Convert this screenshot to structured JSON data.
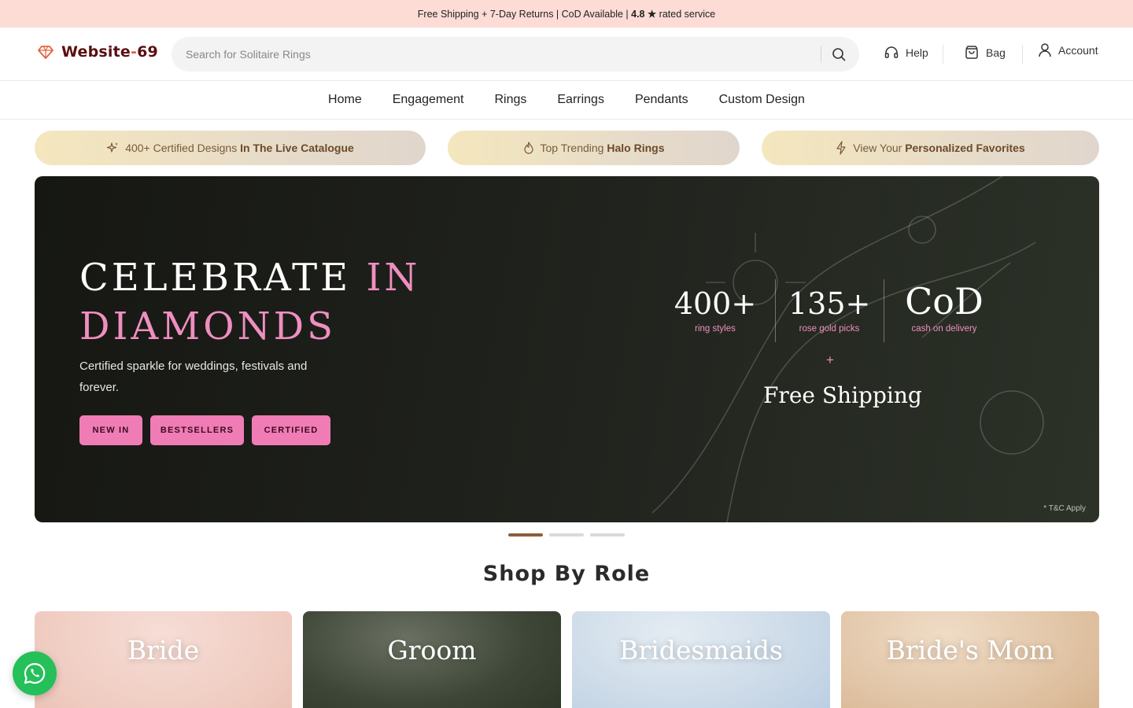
{
  "announcement": {
    "prefix": "Free Shipping + 7-Day Returns | CoD Available | ",
    "rating": "4.8 ★",
    "suffix": " rated service"
  },
  "header": {
    "logo_main": "Website",
    "logo_dash": "-",
    "logo_num": "69",
    "logo_icon": "gem-icon",
    "search_placeholder": "Search for Solitaire Rings",
    "help_label": "Help",
    "bag_label": "Bag",
    "account_label": "Account"
  },
  "nav": {
    "items": [
      "Home",
      "Engagement",
      "Rings",
      "Earrings",
      "Pendants",
      "Custom Design"
    ]
  },
  "promo_pills": [
    {
      "icon": "sparkle-icon",
      "text": "400+ Certified Designs ",
      "bold": "In The Live Catalogue"
    },
    {
      "icon": "flame-icon",
      "text": "Top Trending ",
      "bold": "Halo Rings"
    },
    {
      "icon": "lightning-icon",
      "text": "View Your ",
      "bold": "Personalized Favorites"
    }
  ],
  "hero": {
    "title_white": "CELEBRATE",
    "title_pink_1": "IN",
    "title_pink_2": "DIAMONDS",
    "subtitle": "Certified sparkle for weddings, festivals and forever.",
    "buttons": [
      "NEW IN",
      "BESTSELLERS",
      "CERTIFIED"
    ],
    "stats": [
      {
        "value": "400+",
        "label": "ring styles"
      },
      {
        "value": "135+",
        "label": "rose gold picks"
      },
      {
        "value": "CoD",
        "label": "cash on delivery"
      }
    ],
    "plus": "+",
    "free_shipping": "Free Shipping",
    "tnc": "* T&C Apply"
  },
  "carousel": {
    "total": 3,
    "active": 1
  },
  "shop_by_role": {
    "title": "Shop By Role",
    "roles": [
      "Bride",
      "Groom",
      "Bridesmaids",
      "Bride's Mom"
    ]
  },
  "colors": {
    "announcement_bg": "#fddcd5",
    "brand": "#5a0f12",
    "accent_pink": "#ef8fbf",
    "button_pink": "#f07cb6",
    "whatsapp": "#25c05a"
  }
}
